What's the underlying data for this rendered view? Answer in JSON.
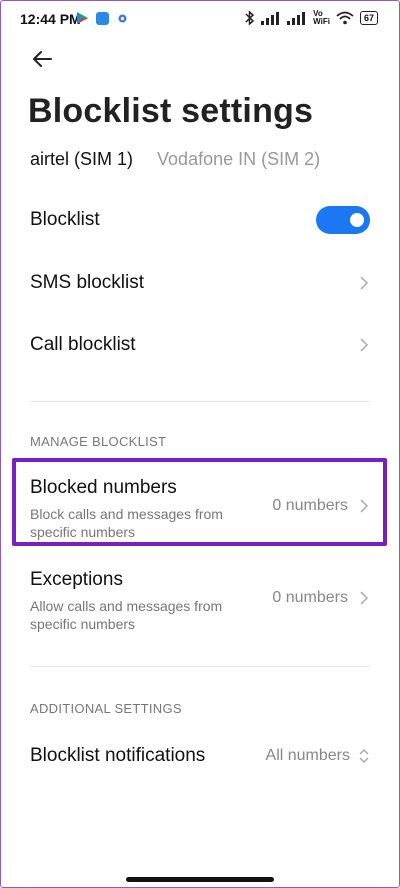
{
  "status_bar": {
    "time": "12:44 PM",
    "volte_label_top": "Vo",
    "volte_label_bottom": "WiFi",
    "battery": "67"
  },
  "header": {
    "title": "Blocklist settings"
  },
  "sim_tabs": [
    {
      "label": "airtel (SIM 1)",
      "active": true
    },
    {
      "label": "Vodafone IN (SIM 2)",
      "active": false
    }
  ],
  "settings": {
    "blocklist_label": "Blocklist",
    "blocklist_enabled": true,
    "sms_blocklist_label": "SMS blocklist",
    "call_blocklist_label": "Call blocklist"
  },
  "manage_section": {
    "header": "MANAGE BLOCKLIST",
    "blocked_numbers": {
      "title": "Blocked numbers",
      "subtitle": "Block calls and messages from specific numbers",
      "value": "0 numbers"
    },
    "exceptions": {
      "title": "Exceptions",
      "subtitle": "Allow calls and messages from specific numbers",
      "value": "0 numbers"
    }
  },
  "additional_section": {
    "header": "ADDITIONAL SETTINGS",
    "notifications": {
      "title": "Blocklist notifications",
      "value": "All numbers"
    }
  },
  "colors": {
    "accent": "#1b77f2",
    "highlight": "#7a1fc1"
  }
}
